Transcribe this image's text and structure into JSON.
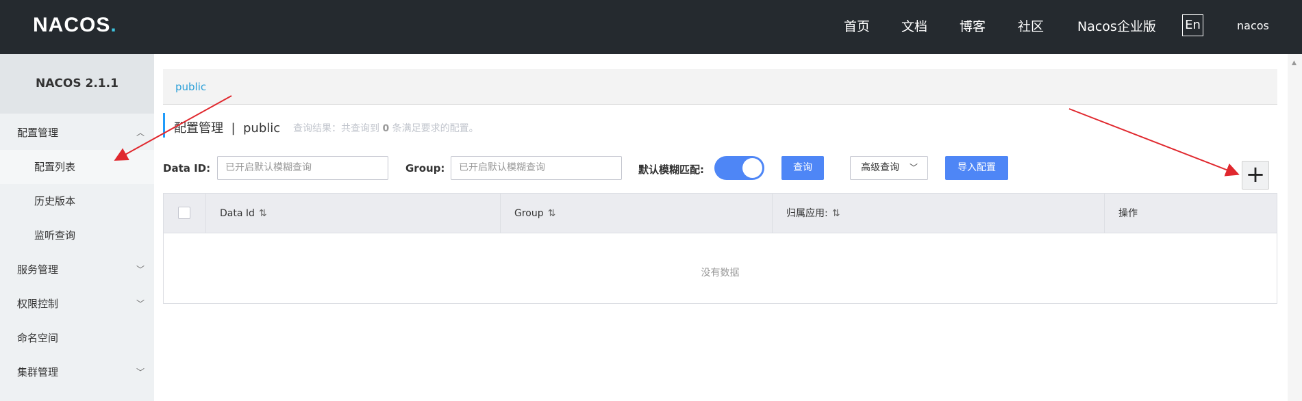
{
  "topbar": {
    "logo_text": "NACOS",
    "logo_dot": ".",
    "nav": [
      "首页",
      "文档",
      "博客",
      "社区",
      "Nacos企业版"
    ],
    "lang": "En",
    "user": "nacos"
  },
  "sidebar": {
    "title": "NACOS 2.1.1",
    "items": [
      {
        "label": "配置管理",
        "expanded": true
      },
      {
        "label": "配置列表",
        "sub": true,
        "active": true
      },
      {
        "label": "历史版本",
        "sub": true
      },
      {
        "label": "监听查询",
        "sub": true
      },
      {
        "label": "服务管理",
        "expanded": false
      },
      {
        "label": "权限控制",
        "expanded": false
      },
      {
        "label": "命名空间"
      },
      {
        "label": "集群管理",
        "expanded": false
      }
    ]
  },
  "breadcrumb": {
    "namespace": "public"
  },
  "header": {
    "title": "配置管理",
    "separator": "|",
    "namespace": "public",
    "hint_prefix": "查询结果：共查询到",
    "hint_count": "0",
    "hint_suffix": "条满足要求的配置。"
  },
  "filters": {
    "data_id_label": "Data ID:",
    "data_id_placeholder": "已开启默认模糊查询",
    "group_label": "Group:",
    "group_placeholder": "已开启默认模糊查询",
    "fuzzy_label": "默认模糊匹配:",
    "fuzzy_enabled": true,
    "search_label": "查询",
    "advanced_label": "高级查询",
    "import_label": "导入配置",
    "add_label": "+"
  },
  "table": {
    "columns": [
      "Data Id",
      "Group",
      "归属应用:",
      "操作"
    ],
    "empty_text": "没有数据"
  },
  "colors": {
    "topbar_bg": "#252a2f",
    "primary": "#4e86f6",
    "link": "#2a9fd8",
    "annotation_arrow": "#e0282e"
  }
}
